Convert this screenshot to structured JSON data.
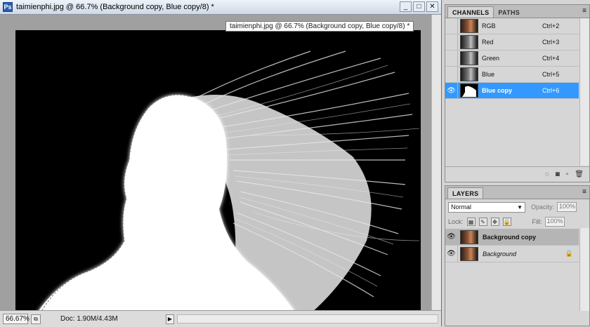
{
  "document": {
    "title": "taimienphi.jpg @ 66.7% (Background copy, Blue copy/8) *",
    "tooltip": "taimienphi.jpg @ 66.7% (Background copy, Blue copy/8) *",
    "window_buttons": {
      "minimize": "_",
      "maximize": "□",
      "close": "✕"
    },
    "status": {
      "zoom": "66.67%",
      "doc_size": "Doc: 1.90M/4.43M",
      "arrow": "▶"
    }
  },
  "channels_panel": {
    "tabs": [
      {
        "label": "CHANNELS",
        "active": true
      },
      {
        "label": "PATHS",
        "active": false
      }
    ],
    "menu_icon": "≡",
    "channels": [
      {
        "name": "RGB",
        "shortcut": "Ctrl+2",
        "thumb": "color",
        "visible": false,
        "selected": false
      },
      {
        "name": "Red",
        "shortcut": "Ctrl+3",
        "thumb": "gray",
        "visible": false,
        "selected": false
      },
      {
        "name": "Green",
        "shortcut": "Ctrl+4",
        "thumb": "gray",
        "visible": false,
        "selected": false
      },
      {
        "name": "Blue",
        "shortcut": "Ctrl+5",
        "thumb": "gray",
        "visible": false,
        "selected": false
      },
      {
        "name": "Blue copy",
        "shortcut": "Ctrl+6",
        "thumb": "mask",
        "visible": true,
        "selected": true
      }
    ],
    "footer_icons": [
      "load-selection-icon",
      "save-selection-icon",
      "new-channel-icon",
      "delete-channel-icon"
    ]
  },
  "layers_panel": {
    "tab": "LAYERS",
    "menu_icon": "≡",
    "blend_mode": "Normal",
    "opacity_label": "Opacity:",
    "opacity_value": "100%",
    "lock_label": "Lock:",
    "fill_label": "Fill:",
    "fill_value": "100%",
    "layers": [
      {
        "name": "Background copy",
        "selected": true,
        "italic": false,
        "locked": false
      },
      {
        "name": "Background",
        "selected": false,
        "italic": true,
        "locked": true
      }
    ]
  }
}
